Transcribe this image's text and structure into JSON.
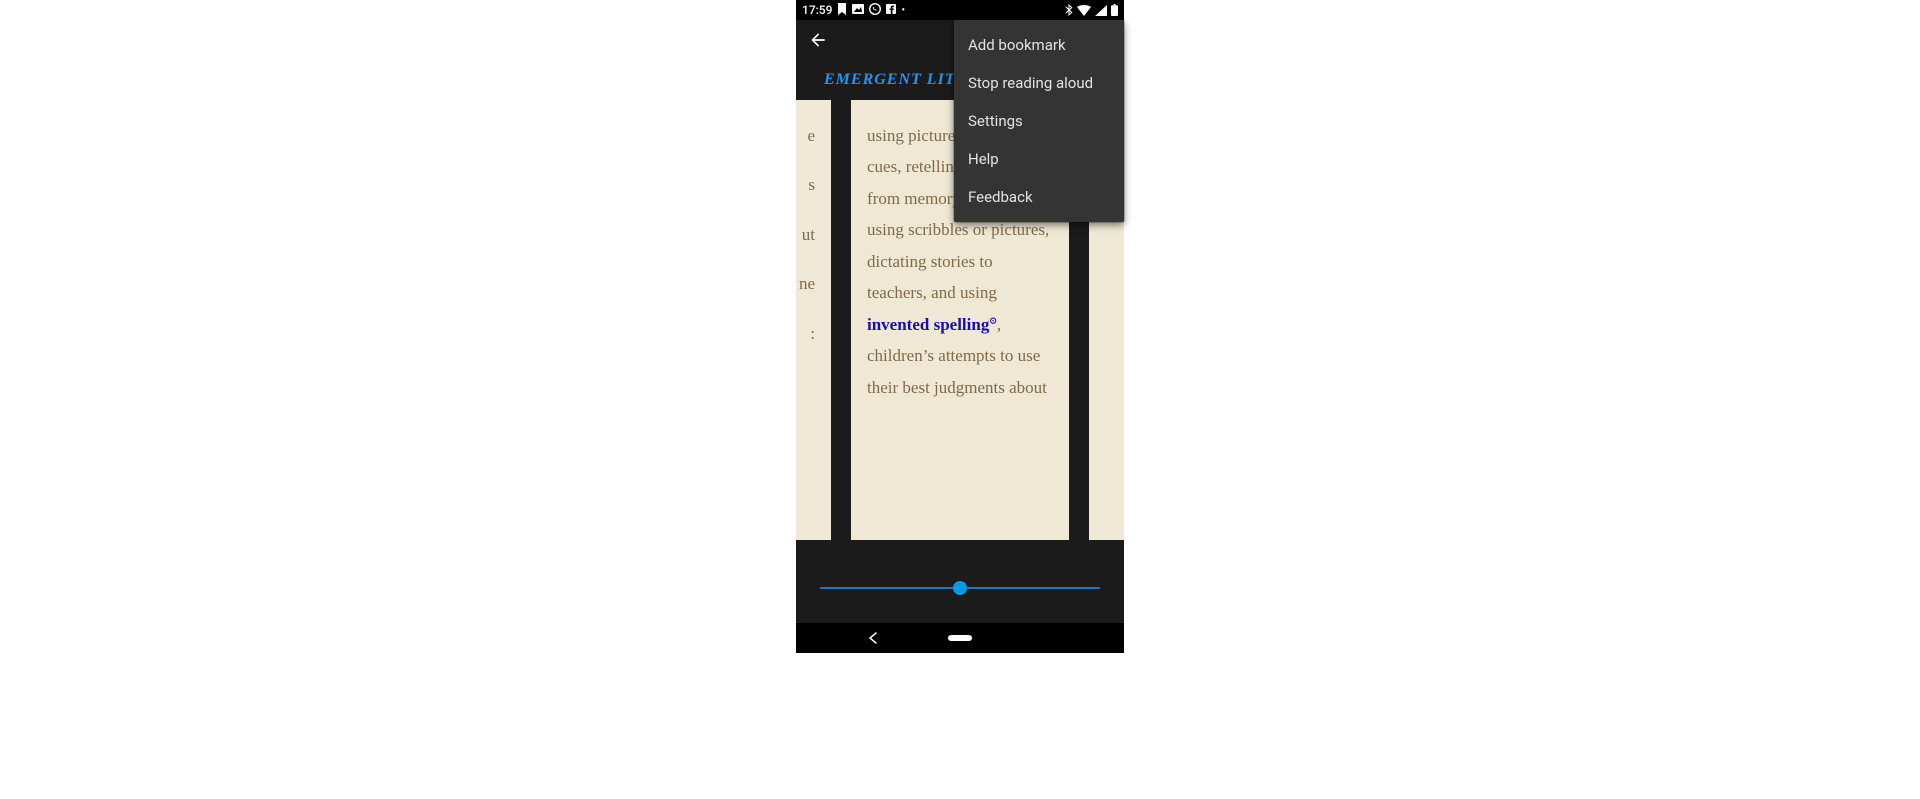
{
  "status": {
    "time": "17:59",
    "icons_left": [
      "bookmark",
      "image",
      "whatsapp",
      "facebook",
      "dot"
    ],
    "icons_right": [
      "bluetooth",
      "wifi",
      "signal",
      "battery"
    ]
  },
  "title": "EMERGENT LIT",
  "menu": {
    "items": [
      "Add bookmark",
      "Stop reading aloud",
      "Settings",
      "Help",
      "Feedback"
    ]
  },
  "pages": {
    "left_fragments": [
      "e",
      "s",
      "ut",
      "ne",
      ":"
    ],
    "center_pre": "using pictures and visual cues, retelling the story from memory, “writing” using scribbles or pictures, dictating stories to teachers, and using ",
    "center_link": "invented spelling",
    "center_post": ", children’s attempts to use their best judgments about"
  },
  "slider": {
    "position_pct": 50
  }
}
